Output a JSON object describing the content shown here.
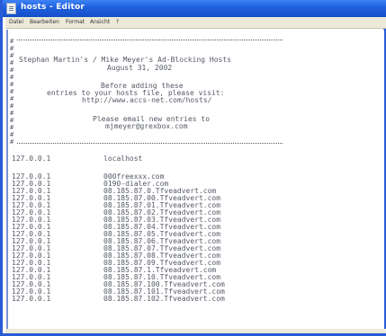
{
  "window": {
    "title": "hosts - Editor"
  },
  "menu": {
    "items": [
      "Datei",
      "Bearbeiten",
      "Format",
      "Ansicht",
      "?"
    ]
  },
  "file": {
    "comment_lines": [
      "Stephan Martin's / Mike Meyer's Ad-Blocking Hosts",
      "August 31, 2002",
      "Before adding these",
      "entries to your hosts file, please visit:",
      "http://www.accs-net.com/hosts/",
      "Please email new entries to",
      "mjmeyer@grexbox.com"
    ],
    "localhost_ip": "127.0.0.1",
    "localhost_name": "localhost",
    "entries": [
      {
        "ip": "127.0.0.1",
        "host": "000freexxx.com"
      },
      {
        "ip": "127.0.0.1",
        "host": "0190-dialer.com"
      },
      {
        "ip": "127.0.0.1",
        "host": "08.185.87.0.Tfveadvert.com"
      },
      {
        "ip": "127.0.0.1",
        "host": "08.185.87.00.Tfveadvert.com"
      },
      {
        "ip": "127.0.0.1",
        "host": "08.185.87.01.Tfveadvert.com"
      },
      {
        "ip": "127.0.0.1",
        "host": "08.185.87.02.Tfveadvert.com"
      },
      {
        "ip": "127.0.0.1",
        "host": "08.185.87.03.Tfveadvert.com"
      },
      {
        "ip": "127.0.0.1",
        "host": "08.185.87.04.Tfveadvert.com"
      },
      {
        "ip": "127.0.0.1",
        "host": "08.185.87.05.Tfveadvert.com"
      },
      {
        "ip": "127.0.0.1",
        "host": "08.185.87.06.Tfveadvert.com"
      },
      {
        "ip": "127.0.0.1",
        "host": "08.185.87.07.Tfveadvert.com"
      },
      {
        "ip": "127.0.0.1",
        "host": "08.185.87.08.Tfveadvert.com"
      },
      {
        "ip": "127.0.0.1",
        "host": "08.185.87.09.Tfveadvert.com"
      },
      {
        "ip": "127.0.0.1",
        "host": "08.185.87.1.Tfveadvert.com"
      },
      {
        "ip": "127.0.0.1",
        "host": "08.185.87.10.Tfveadvert.com"
      },
      {
        "ip": "127.0.0.1",
        "host": "08.185.87.100.Tfveadvert.com"
      },
      {
        "ip": "127.0.0.1",
        "host": "08.185.87.101.Tfveadvert.com"
      },
      {
        "ip": "127.0.0.1",
        "host": "08.185.87.102.Tfveadvert.com"
      }
    ]
  },
  "colors": {
    "titlebar": "#1f5fdc",
    "menubar": "#ece9d8",
    "text": "#555a66"
  }
}
